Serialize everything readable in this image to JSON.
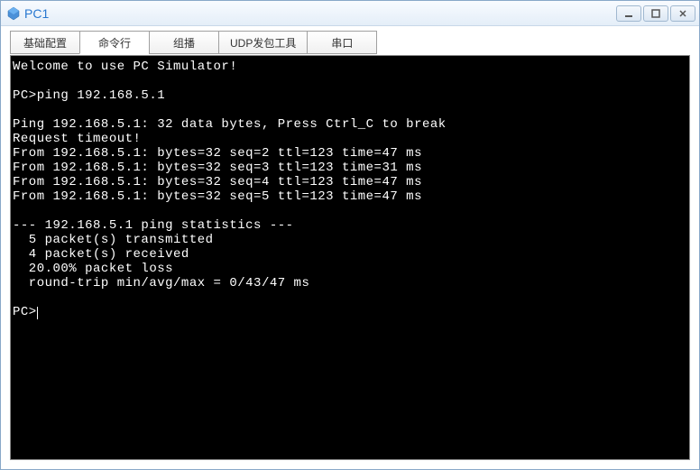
{
  "window": {
    "title": "PC1"
  },
  "tabs": [
    {
      "label": "基础配置"
    },
    {
      "label": "命令行"
    },
    {
      "label": "组播"
    },
    {
      "label": "UDP发包工具"
    },
    {
      "label": "串口"
    }
  ],
  "terminal": {
    "welcome": "Welcome to use PC Simulator!",
    "blank1": "",
    "prompt1": "PC>ping 192.168.5.1",
    "blank2": "",
    "header": "Ping 192.168.5.1: 32 data bytes, Press Ctrl_C to break",
    "timeout": "Request timeout!",
    "reply1": "From 192.168.5.1: bytes=32 seq=2 ttl=123 time=47 ms",
    "reply2": "From 192.168.5.1: bytes=32 seq=3 ttl=123 time=31 ms",
    "reply3": "From 192.168.5.1: bytes=32 seq=4 ttl=123 time=47 ms",
    "reply4": "From 192.168.5.1: bytes=32 seq=5 ttl=123 time=47 ms",
    "blank3": "",
    "stats_header": "--- 192.168.5.1 ping statistics ---",
    "stats_tx": "  5 packet(s) transmitted",
    "stats_rx": "  4 packet(s) received",
    "stats_loss": "  20.00% packet loss",
    "stats_rtt": "  round-trip min/avg/max = 0/43/47 ms",
    "blank4": "",
    "prompt2": "PC>"
  }
}
